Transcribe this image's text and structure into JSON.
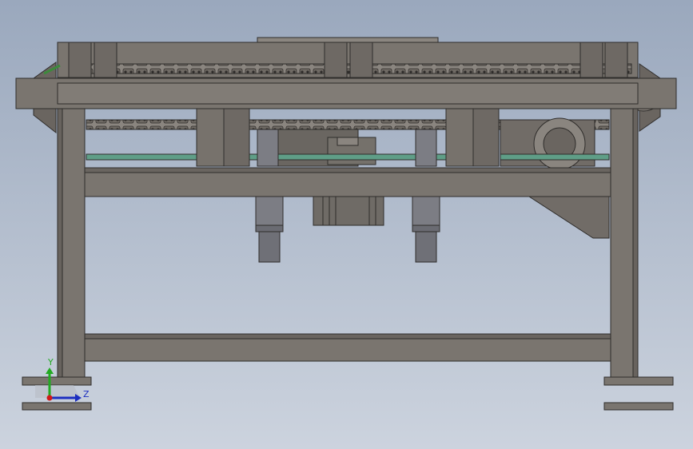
{
  "viewport": {
    "background_top": "#9aa8bd",
    "background_bottom": "#ccd3de"
  },
  "model": {
    "frame_color": "#77726c",
    "frame_dark": "#5e5a55",
    "edge_color": "#2f2d2b",
    "guide_color": "#5f9e87",
    "cylinder_color": "#7c7d84"
  },
  "triad": {
    "y_label": "Y",
    "z_label": "Z",
    "y_color": "#22aa22",
    "z_color": "#1c2ec0",
    "origin_color": "#d01818",
    "icon": "coordinate-triad-icon"
  }
}
